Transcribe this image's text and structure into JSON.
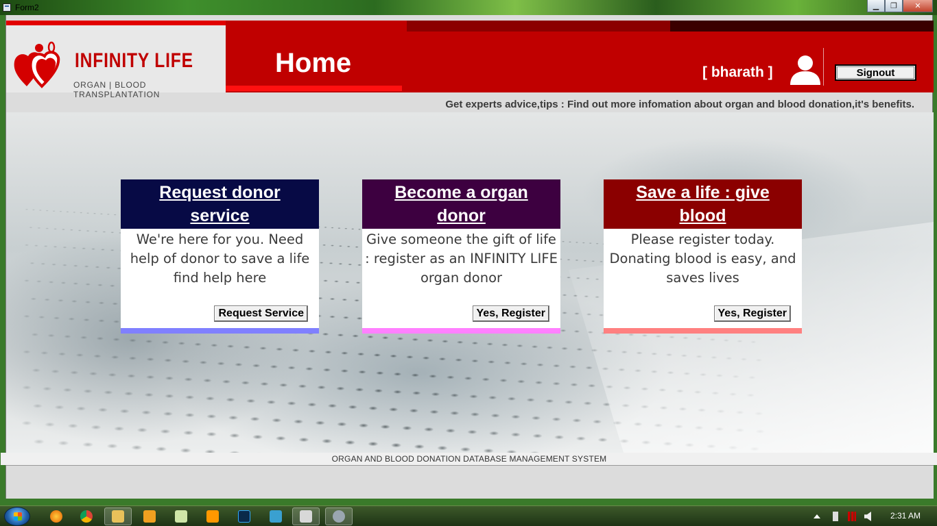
{
  "window": {
    "title": "Form2",
    "minimize_label": "▁",
    "maximize_label": "❐",
    "close_label": "✕"
  },
  "logo": {
    "name": "INFINITY  LIFE",
    "tagline": "ORGAN | BLOOD  TRANSPLANTATION"
  },
  "header": {
    "page_title": "Home",
    "username": "[ bharath ]",
    "signout_label": "Signout"
  },
  "tips": "Get experts advice,tips : Find out more infomation about organ and blood donation,it's benefits.",
  "cards": [
    {
      "title": "Request donor service",
      "body": "We're here for you. Need help of donor to save a life find help here",
      "button": "Request Service",
      "head_color": "#070a45",
      "foot_color": "#8080ff"
    },
    {
      "title": "Become a organ donor",
      "body": "Give someone the gift of life : register as an INFINITY LIFE organ donor",
      "button": "Yes, Register",
      "head_color": "#3d0040",
      "foot_color": "#ff80ff"
    },
    {
      "title": "Save  a life : give blood",
      "body": "Please register today. Donating blood is easy, and saves lives",
      "button": "Yes, Register",
      "head_color": "#8b0000",
      "foot_color": "#ff8080"
    }
  ],
  "footer": "ORGAN AND BLOOD DONATION DATABASE MANAGEMENT SYSTEM",
  "taskbar": {
    "items": [
      "firefox-icon",
      "chrome-icon",
      "file-explorer-icon",
      "media-player-icon",
      "notepad-icon",
      "sublime-text-icon",
      "photoshop-icon",
      "app-icon",
      "form-app-icon",
      "paint-icon"
    ],
    "clock": "2:31 AM"
  },
  "colors": {
    "brand_red": "#c00000",
    "bright_red": "#e10000"
  }
}
